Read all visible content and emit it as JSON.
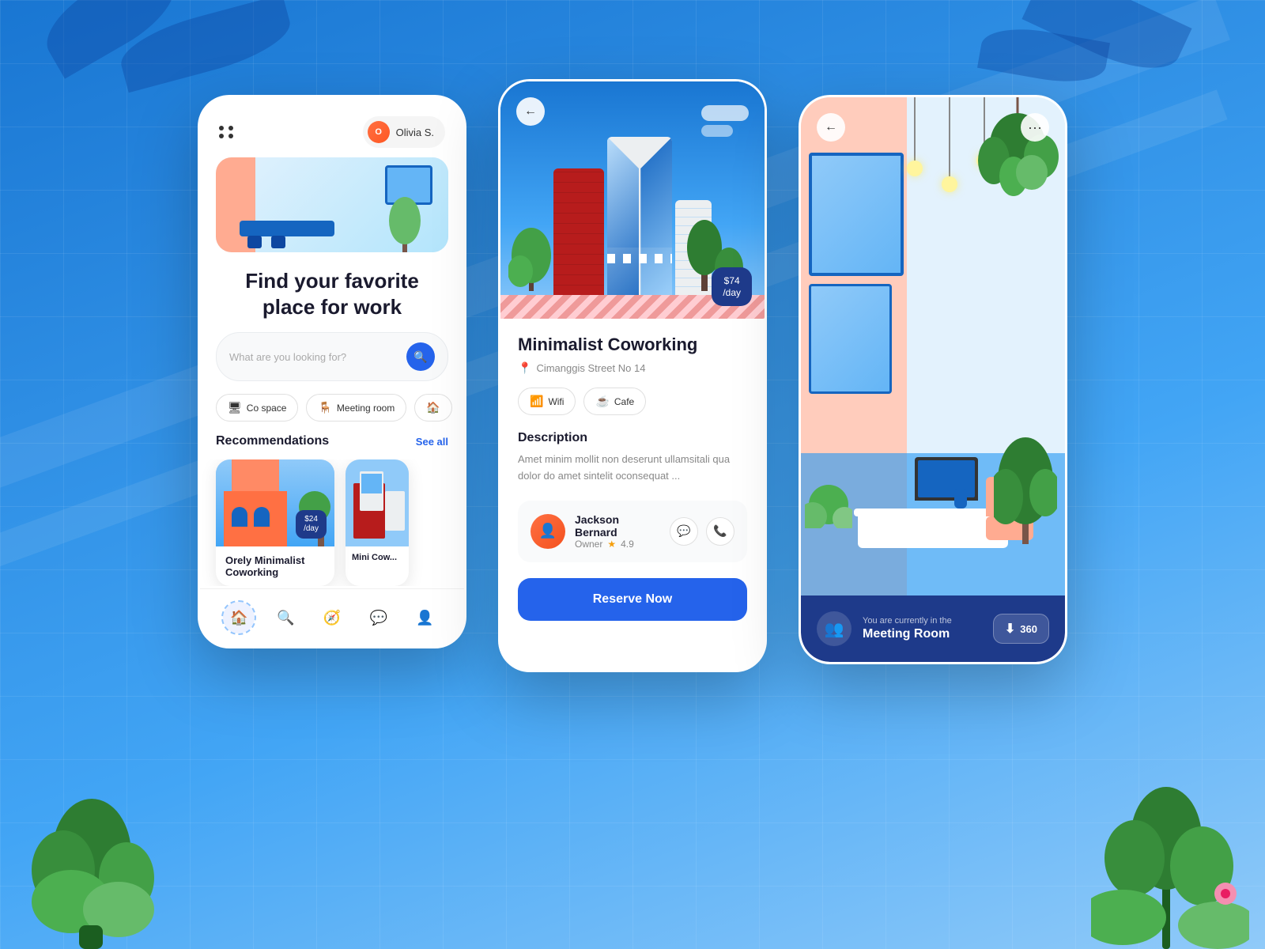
{
  "background": {
    "color": "#1976D2"
  },
  "phone1": {
    "header": {
      "user_name": "Olivia S."
    },
    "title": "Find your favorite place for work",
    "search": {
      "placeholder": "What are you looking for?"
    },
    "filters": [
      {
        "label": "Co space",
        "icon": "🖥"
      },
      {
        "label": "Meeting room",
        "icon": "🪑"
      }
    ],
    "recommendations": {
      "title": "Recommendations",
      "see_all": "See all",
      "items": [
        {
          "name": "Orely Minimalist Coworking",
          "price": "$24",
          "unit": "/day"
        },
        {
          "name": "Mini Cow...",
          "price": "",
          "unit": ""
        }
      ]
    },
    "nav": [
      "home",
      "search",
      "compass",
      "chat",
      "profile"
    ]
  },
  "phone2": {
    "place_name": "Minimalist Coworking",
    "address": "Cimanggis Street No 14",
    "price": "$74",
    "price_unit": "/day",
    "amenities": [
      {
        "label": "Wifi",
        "icon": "📶"
      },
      {
        "label": "Cafe",
        "icon": "☕"
      }
    ],
    "description": {
      "title": "Description",
      "text": "Amet minim mollit non deserunt ullamsitali qua dolor do amet sintelit oconsequat ..."
    },
    "owner": {
      "name": "Jackson Bernard",
      "role": "Owner",
      "rating": "4.9"
    },
    "reserve_btn": "Reserve Now"
  },
  "phone3": {
    "room": {
      "currently_in": "You are currently in the",
      "room_name": "Meeting Room",
      "view_label": "360"
    }
  }
}
